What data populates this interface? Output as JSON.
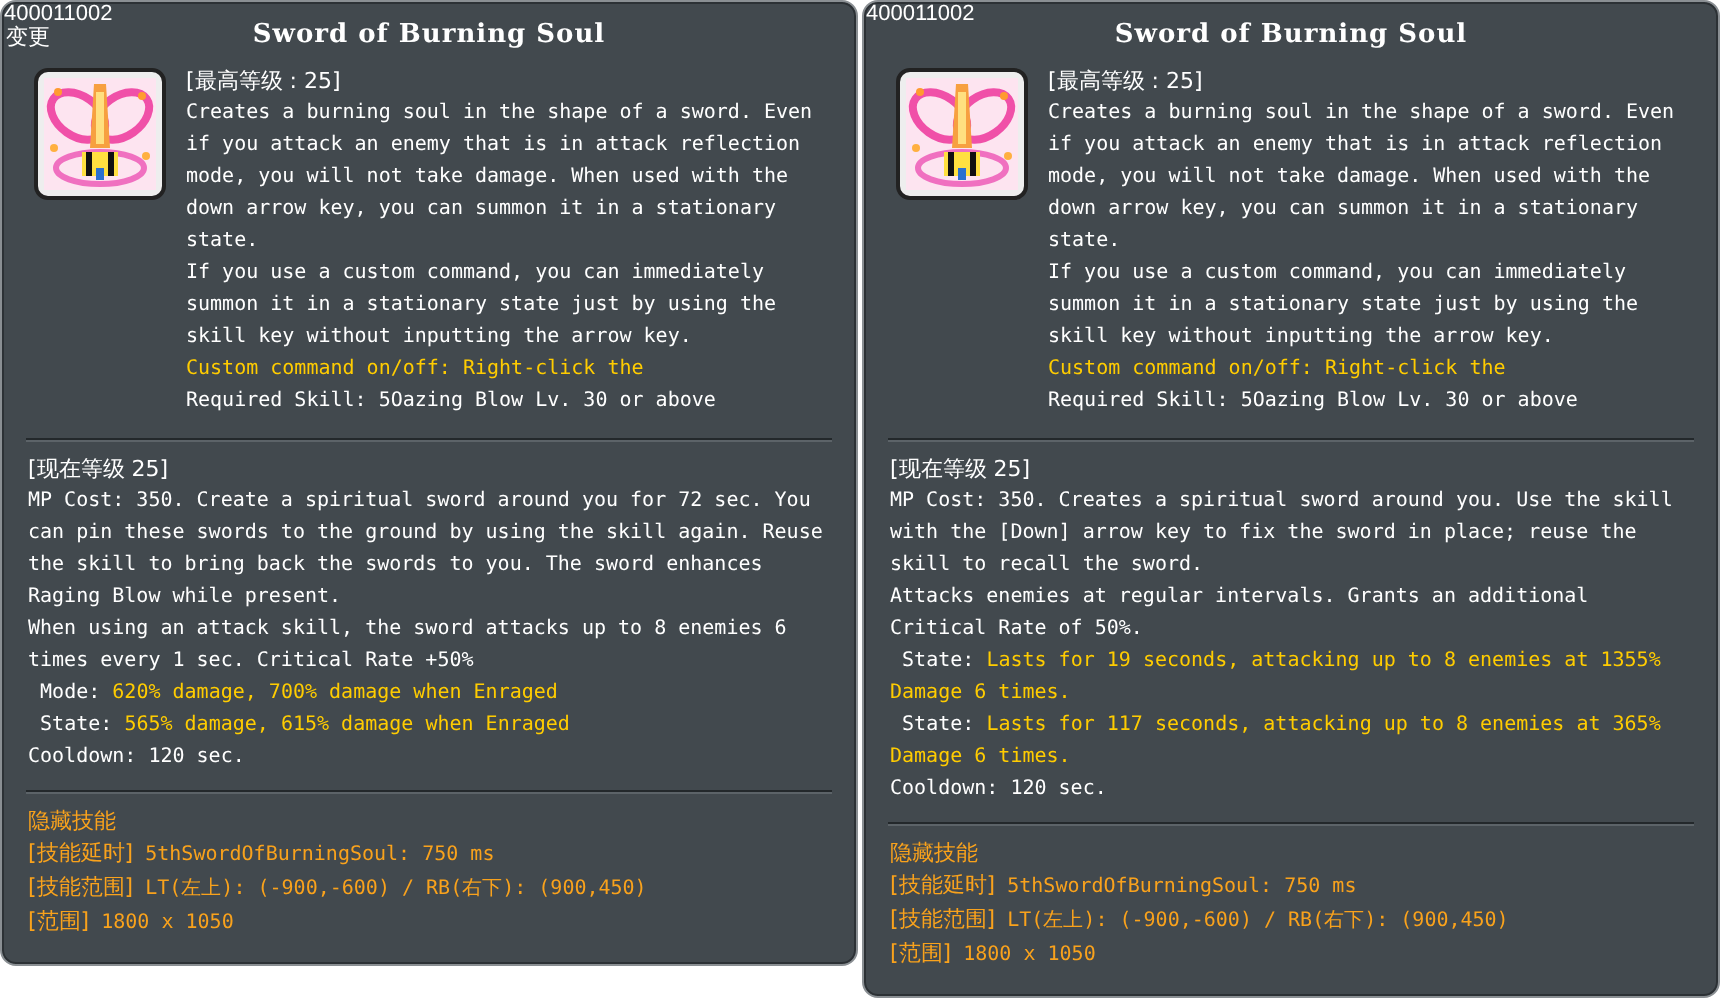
{
  "panels": [
    {
      "id": "400011002",
      "tag": "变更",
      "title": "Sword of Burning Soul",
      "max_level": "[最高等级 : 25]",
      "description": [
        {
          "segments": [
            {
              "text": "Creates a burning soul in the shape of a sword. Even if you attack an enemy that is in attack reflection mode, you will not take damage. When used with the down arrow key, you can summon it in a stationary state.",
              "highlight": false
            }
          ]
        },
        {
          "segments": [
            {
              "text": "If you use a custom command, you can immediately summon it in a stationary state just by using the skill key without inputting the arrow key.",
              "highlight": false
            }
          ]
        },
        {
          "segments": [
            {
              "text": "Custom command on/off: Right-click the",
              "highlight": true
            }
          ]
        },
        {
          "segments": [
            {
              "text": "Required Skill: 5Oazing Blow Lv. 30 or above",
              "highlight": false
            }
          ]
        }
      ],
      "current_level": "[现在等级 25]",
      "effects": [
        {
          "segments": [
            {
              "text": "MP Cost: 350. Create a spiritual sword around you for 72 sec. You can pin these swords to the ground by using the skill again. Reuse the skill to bring back the swords to you. The sword enhances Raging Blow while present.",
              "highlight": false
            }
          ]
        },
        {
          "segments": [
            {
              "text": "When using an attack skill, the sword attacks up to 8 enemies 6 times every 1 sec. Critical Rate +50%",
              "highlight": false
            }
          ]
        },
        {
          "segments": [
            {
              "text": " Mode: ",
              "highlight": false
            },
            {
              "text": "620% damage, 700% damage when Enraged",
              "highlight": true
            }
          ]
        },
        {
          "segments": [
            {
              "text": " State: ",
              "highlight": false
            },
            {
              "text": "565% damage, 615% damage when Enraged",
              "highlight": true
            }
          ]
        },
        {
          "segments": [
            {
              "text": "Cooldown: 120 sec.",
              "highlight": false
            }
          ]
        }
      ],
      "hidden_title": "隐藏技能",
      "hidden_lines": [
        {
          "label": "[技能延时]",
          "value": "5thSwordOfBurningSoul: 750 ms"
        },
        {
          "label": "[技能范围]",
          "value": "LT(左上): (-900,-600) / RB(右下): (900,450)"
        },
        {
          "label": "[范围]",
          "value": "1800 x 1050"
        }
      ]
    },
    {
      "id": "400011002",
      "title": "Sword of Burning Soul",
      "max_level": "[最高等级 : 25]",
      "description": [
        {
          "segments": [
            {
              "text": "Creates a burning soul in the shape of a sword. Even if you attack an enemy that is in attack reflection mode, you will not take damage. When used with the down arrow key, you can summon it in a stationary state.",
              "highlight": false
            }
          ]
        },
        {
          "segments": [
            {
              "text": "If you use a custom command, you can immediately summon it in a stationary state just by using the skill key without inputting the arrow key.",
              "highlight": false
            }
          ]
        },
        {
          "segments": [
            {
              "text": "Custom command on/off: Right-click the",
              "highlight": true
            }
          ]
        },
        {
          "segments": [
            {
              "text": "Required Skill: 5Oazing Blow Lv. 30 or above",
              "highlight": false
            }
          ]
        }
      ],
      "current_level": "[现在等级 25]",
      "effects": [
        {
          "segments": [
            {
              "text": "MP Cost: 350. Creates a spiritual sword around you. Use the skill with the [Down] arrow key to fix the sword in place; reuse the skill to recall the sword.",
              "highlight": false
            }
          ]
        },
        {
          "segments": [
            {
              "text": "Attacks enemies at regular intervals. Grants an additional Critical Rate of 50%.",
              "highlight": false
            }
          ]
        },
        {
          "segments": [
            {
              "text": " State: ",
              "highlight": false
            },
            {
              "text": "Lasts for 19 seconds, attacking up to 8 enemies at 1355% Damage 6 times.",
              "highlight": true
            }
          ]
        },
        {
          "segments": [
            {
              "text": " State: ",
              "highlight": false
            },
            {
              "text": "Lasts for 117 seconds, attacking up to 8 enemies at 365% Damage 6 times.",
              "highlight": true
            }
          ]
        },
        {
          "segments": [
            {
              "text": "Cooldown: 120 sec.",
              "highlight": false
            }
          ]
        }
      ],
      "hidden_title": "隐藏技能",
      "hidden_lines": [
        {
          "label": "[技能延时]",
          "value": "5thSwordOfBurningSoul: 750 ms"
        },
        {
          "label": "[技能范围]",
          "value": "LT(左上): (-900,-600) / RB(右下): (900,450)"
        },
        {
          "label": "[范围]",
          "value": "1800 x 1050"
        }
      ]
    }
  ]
}
